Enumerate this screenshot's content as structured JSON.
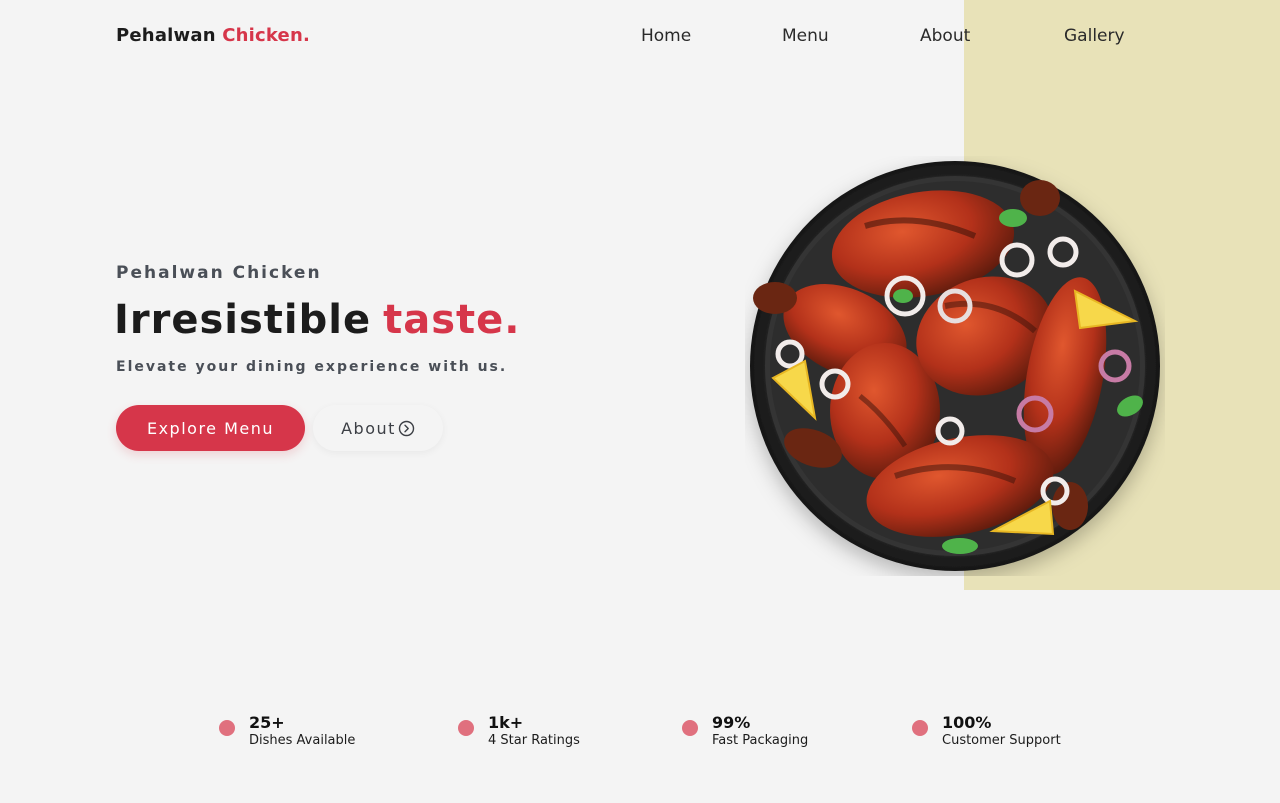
{
  "header": {
    "logo_main": "Pehalwan",
    "logo_accent": "Chicken.",
    "nav": [
      {
        "label": "Home"
      },
      {
        "label": "Menu"
      },
      {
        "label": "About"
      },
      {
        "label": "Gallery"
      }
    ]
  },
  "hero": {
    "eyebrow": "Pehalwan Chicken",
    "title_main": "Irresistible",
    "title_accent": "taste.",
    "subtitle": "Elevate your dining experience with us.",
    "primary_button": "Explore Menu",
    "secondary_button": "About",
    "secondary_icon": "chevron-right-circle-icon"
  },
  "image": {
    "subject": "plate-of-tandoori-chicken-icon"
  },
  "stats": [
    {
      "value": "25+",
      "label": "Dishes Available"
    },
    {
      "value": "1k+",
      "label": "4 Star Ratings"
    },
    {
      "value": "99%",
      "label": "Fast Packaging"
    },
    {
      "value": "100%",
      "label": "Customer Support"
    }
  ],
  "colors": {
    "accent": "#d6364a",
    "panel": "#e8e2b8",
    "background": "#f4f4f4",
    "dot": "#e0707e"
  }
}
